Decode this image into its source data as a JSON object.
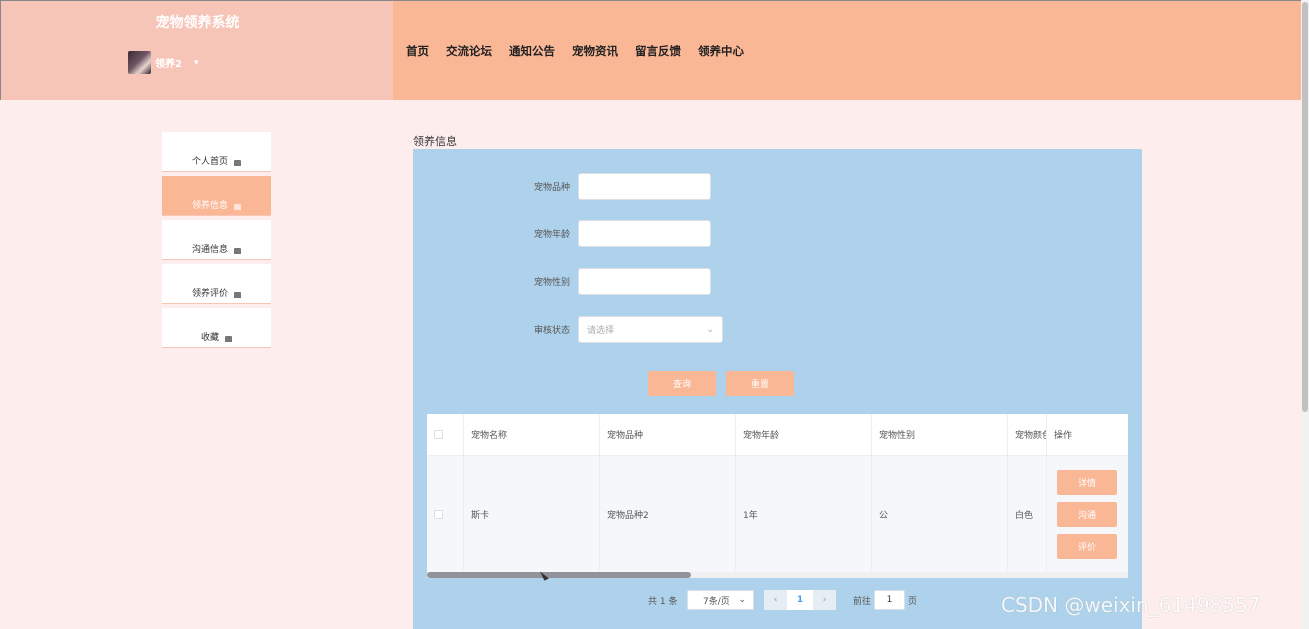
{
  "header": {
    "site_title": "宠物领养系统",
    "user_name": "领养2",
    "user_caret": "▾",
    "nav": [
      "首页",
      "交流论坛",
      "通知公告",
      "宠物资讯",
      "留言反馈",
      "领养中心"
    ]
  },
  "sidebar": {
    "items": [
      {
        "label": "个人首页",
        "active": false
      },
      {
        "label": "领养信息",
        "active": true
      },
      {
        "label": "沟通信息",
        "active": false
      },
      {
        "label": "领养评价",
        "active": false
      },
      {
        "label": "收藏",
        "active": false
      }
    ]
  },
  "main": {
    "page_title": "领养信息",
    "filters": {
      "breed_label": "宠物品种",
      "age_label": "宠物年龄",
      "gender_label": "宠物性别",
      "status_label": "审核状态",
      "status_placeholder": "请选择"
    },
    "buttons": {
      "search": "查询",
      "reset": "重置"
    },
    "table": {
      "headers": [
        "宠物名称",
        "宠物品种",
        "宠物年龄",
        "宠物性别",
        "宠物颜色",
        "操作"
      ],
      "rows": [
        {
          "name": "斯卡",
          "breed": "宠物品种2",
          "age": "1年",
          "gender": "公",
          "color": "白色"
        }
      ],
      "actions": {
        "detail": "详情",
        "chat": "沟通",
        "review": "评价"
      }
    },
    "pagination": {
      "total": "共 1 条",
      "page_size": "7条/页",
      "current_page": "1",
      "goto_label": "前往",
      "goto_value": "1",
      "page_unit": "页"
    }
  },
  "watermark": "CSDN @weixin_61498557",
  "colors": {
    "accent": "#fab796",
    "panel": "#aed2eb",
    "brand": "#f7c4b8",
    "background": "#fdeeed"
  }
}
